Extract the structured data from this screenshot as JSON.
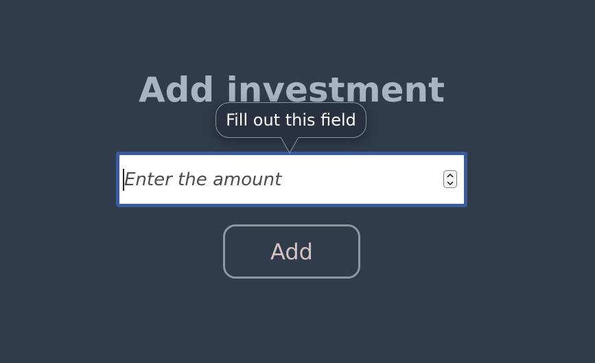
{
  "title": "Add investment",
  "amount_input": {
    "value": "",
    "placeholder": "Enter the amount"
  },
  "stepper": {
    "up_icon": "chevron-up-icon",
    "down_icon": "chevron-down-icon"
  },
  "tooltip": {
    "text": "Fill out this field"
  },
  "add_button": {
    "label": "Add"
  },
  "colors": {
    "background": "#313c4b",
    "title": "#a7b4c4",
    "focus_border": "#3a5a9e",
    "button_border": "#8f97a5",
    "button_text": "#d7c2c2",
    "tooltip_bg": "#273140"
  }
}
